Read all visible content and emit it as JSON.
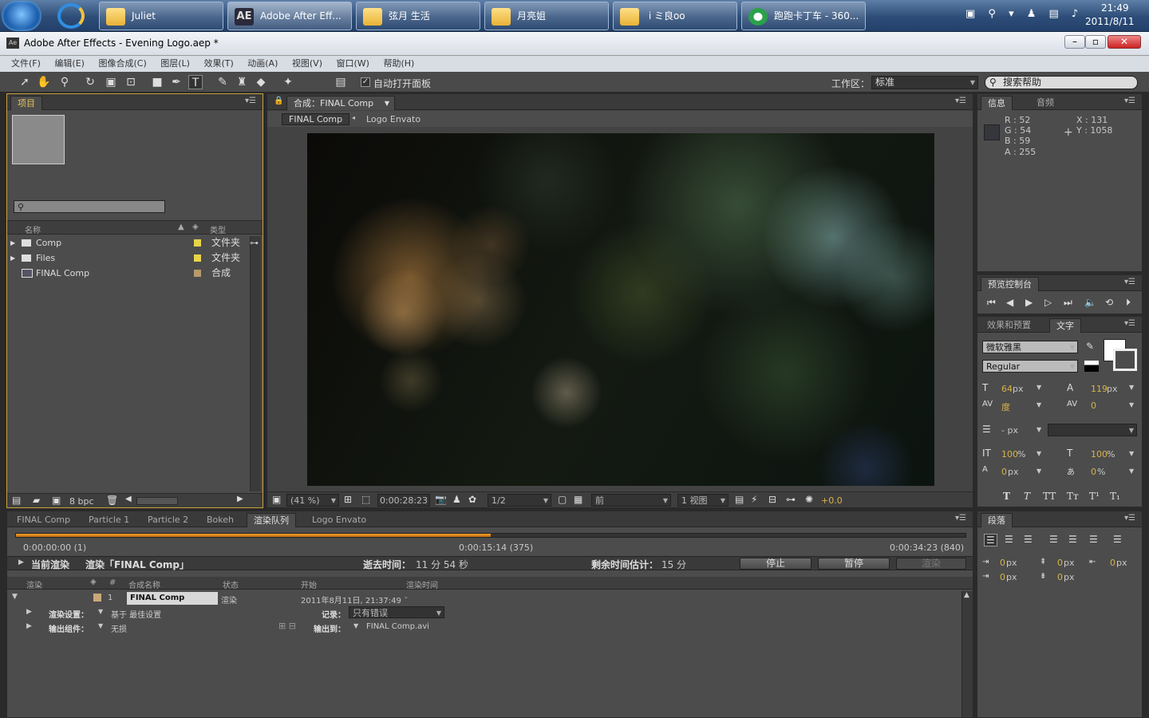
{
  "taskbar": {
    "items": [
      {
        "label": "Juliet"
      },
      {
        "label": "Adobe After Eff...",
        "badge": "AE"
      },
      {
        "label": "弦月 生活"
      },
      {
        "label": "月亮姐"
      },
      {
        "label": " i ミ良oo"
      },
      {
        "label": "跑跑卡丁车 - 360..."
      }
    ],
    "clock_time": "21:49",
    "clock_date": "2011/8/11"
  },
  "window": {
    "title": "Adobe After Effects - Evening Logo.aep *",
    "icon": "Ae"
  },
  "menu": [
    "文件(F)",
    "编辑(E)",
    "图像合成(C)",
    "图层(L)",
    "效果(T)",
    "动画(A)",
    "视图(V)",
    "窗口(W)",
    "帮助(H)"
  ],
  "toolbar": {
    "auto_open_label": "自动打开面板",
    "workspace_label": "工作区：",
    "workspace_value": "标准",
    "search_placeholder": "搜索帮助"
  },
  "project": {
    "tab": "项目",
    "col_name": "名称",
    "col_type": "类型",
    "items": [
      {
        "name": "Comp",
        "type": "文件夹",
        "color": "#e8d44a"
      },
      {
        "name": "Files",
        "type": "文件夹",
        "color": "#e8d44a"
      },
      {
        "name": "FINAL Comp",
        "type": "合成",
        "color": "#b89a6a"
      }
    ],
    "bpc": "8 bpc"
  },
  "comp": {
    "tab": "合成：FINAL Comp",
    "crumb1": "FINAL Comp",
    "crumb2": "Logo Envato",
    "zoom": "(41 %)",
    "timecode": "0:00:28:23",
    "resolution": "1/2",
    "view": "前",
    "views": "1 视图",
    "exposure": "+0.0"
  },
  "info": {
    "tab1": "信息",
    "tab2": "音频",
    "r": "R : 52",
    "g": "G : 54",
    "b": "B : 59",
    "a": "A : 255",
    "x": "X : 131",
    "y": "Y : 1058"
  },
  "preview": {
    "tab": "预览控制台"
  },
  "char": {
    "tab1": "效果和预置",
    "tab2": "文字",
    "font": "微软雅黑",
    "style": "Regular",
    "size": "64",
    "size_unit": "px",
    "leading": "119",
    "leading_unit": "px",
    "kerning": "度",
    "tracking": "0",
    "stroke_unit": "- px",
    "vscale": "100",
    "vscale_unit": "%",
    "hscale": "100",
    "hscale_unit": "%",
    "baseline": "0",
    "baseline_unit": "px",
    "tsume": "0",
    "tsume_unit": "%"
  },
  "paragraph": {
    "tab": "段落",
    "v1": "0",
    "v2": "0",
    "v3": "0",
    "v4": "0",
    "v5": "0",
    "unit": "px"
  },
  "bottom_tabs": [
    "FINAL Comp",
    "Particle 1",
    "Particle 2",
    "Bokeh",
    "渲染队列",
    "Logo Envato"
  ],
  "render": {
    "t_start": "0:00:00:00 (1)",
    "t_mid": "0:00:15:14 (375)",
    "t_end": "0:00:34:23 (840)",
    "current_label": "当前渲染",
    "rendering": "渲染「FINAL Comp」",
    "elapsed_label": "逝去时间：",
    "elapsed": "11 分 54 秒",
    "remain_label": "剩余时间估计：",
    "remain": "15 分",
    "stop": "停止",
    "pause": "暂停",
    "render_btn": "渲染",
    "col_render": "渲染",
    "col_num": "#",
    "col_comp": "合成名称",
    "col_status": "状态",
    "col_start": "开始",
    "col_time": "渲染时间",
    "row_num": "1",
    "row_comp": "FINAL Comp",
    "row_status": "渲染",
    "row_start": "2011年8月11日, 21:37:49",
    "row_time": "-",
    "settings_label": "渲染设置：",
    "settings_value": "基于 最佳设置",
    "log_label": "记录：",
    "log_value": "只有错误",
    "output_label": "输出组件：",
    "output_value": "无损",
    "output_to_label": "输出到：",
    "output_to_value": "FINAL Comp.avi",
    "progress": 0.5
  }
}
